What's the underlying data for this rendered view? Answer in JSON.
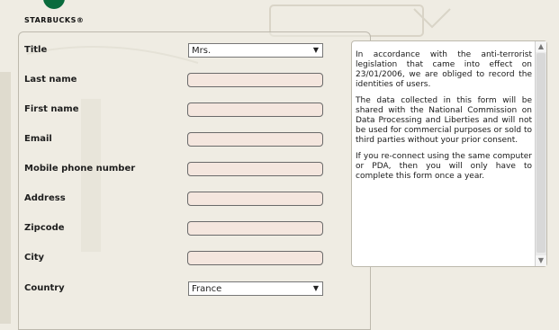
{
  "brand": {
    "name": "STARBUCKS®"
  },
  "form": {
    "fields": [
      {
        "label": "Title",
        "type": "select",
        "value": "Mrs."
      },
      {
        "label": "Last name",
        "type": "text"
      },
      {
        "label": "First name",
        "type": "text"
      },
      {
        "label": "Email",
        "type": "text"
      },
      {
        "label": "Mobile phone number",
        "type": "text"
      },
      {
        "label": "Address",
        "type": "text"
      },
      {
        "label": "Zipcode",
        "type": "text"
      },
      {
        "label": "City",
        "type": "text"
      },
      {
        "label": "Country",
        "type": "select",
        "value": "France"
      }
    ]
  },
  "info": {
    "paragraphs": [
      "In accordance with the anti-terrorist legislation that came into effect on 23/01/2006, we are obliged to record the identities of users.",
      "The data collected in this form will be shared with the National Commission on Data Processing and Liberties and will not be used for commercial purposes or sold to third parties without your prior consent.",
      "If you re-connect using the same computer or PDA, then you will only have to complete this form once a year."
    ]
  },
  "colors": {
    "background": "#efece3",
    "input_fill": "#f4e6de",
    "brand_green": "#0a6b3d"
  },
  "icons": {
    "select_arrow": "triangle-down-icon",
    "scroll_up": "chevron-up-icon",
    "scroll_down": "chevron-down-icon"
  }
}
